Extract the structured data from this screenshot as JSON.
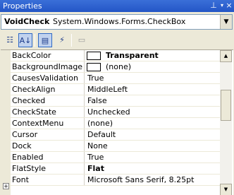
{
  "window": {
    "title": "Properties"
  },
  "selector": {
    "name": "VoidCheck",
    "type": "System.Windows.Forms.CheckBox"
  },
  "toolbar": [
    "categorized-icon",
    "alphabetical-icon",
    "properties-icon",
    "events-icon",
    "property-pages-icon"
  ],
  "properties": [
    {
      "name": "BackColor",
      "value": "Transparent",
      "swatch": true,
      "bold": true
    },
    {
      "name": "BackgroundImage",
      "value": "(none)",
      "swatch": true,
      "bold": false
    },
    {
      "name": "CausesValidation",
      "value": "True",
      "bold": false
    },
    {
      "name": "CheckAlign",
      "value": "MiddleLeft",
      "bold": false
    },
    {
      "name": "Checked",
      "value": "False",
      "bold": false
    },
    {
      "name": "CheckState",
      "value": "Unchecked",
      "bold": false
    },
    {
      "name": "ContextMenu",
      "value": "(none)",
      "bold": false
    },
    {
      "name": "Cursor",
      "value": "Default",
      "bold": false
    },
    {
      "name": "Dock",
      "value": "None",
      "bold": false
    },
    {
      "name": "Enabled",
      "value": "True",
      "bold": false
    },
    {
      "name": "FlatStyle",
      "value": "Flat",
      "bold": true
    },
    {
      "name": "Font",
      "value": "Microsoft Sans Serif, 8.25pt",
      "bold": false
    }
  ]
}
